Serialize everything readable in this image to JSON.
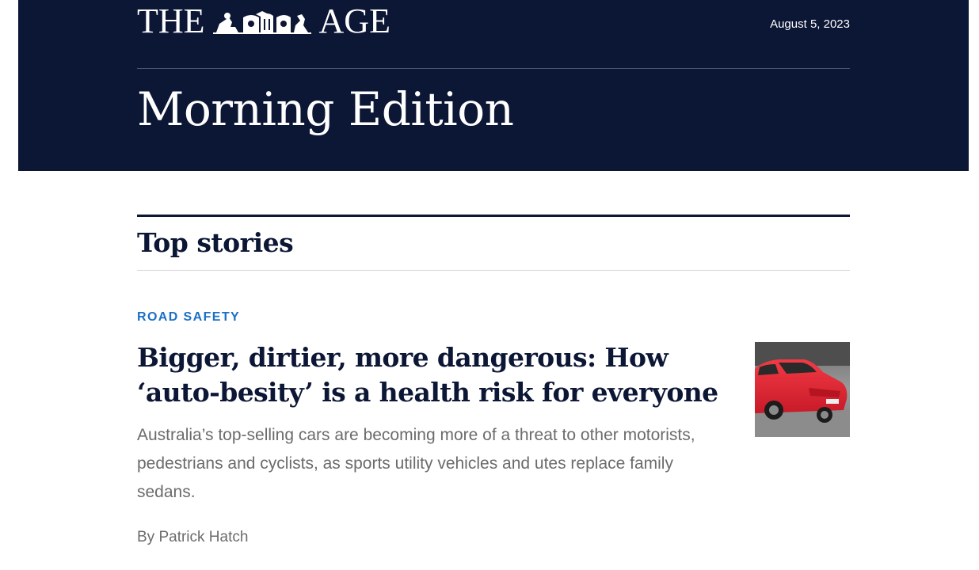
{
  "masthead": {
    "logo_left": "THE",
    "logo_right": "AGE",
    "crest_icon": "coat-of-arms-icon",
    "date": "August 5, 2023",
    "edition": "Morning Edition",
    "background": "#0c1635"
  },
  "section": {
    "title": "Top stories"
  },
  "story": {
    "kicker": "ROAD SAFETY",
    "headline": "Bigger, dirtier, more dangerous: How ‘auto-besity’ is a health risk for everyone",
    "summary": "Australia’s top-selling cars are becoming more of a threat to other motorists, pedestrians and cyclists, as sports utility vehicles and utes replace family sedans.",
    "byline": "By Patrick Hatch",
    "image_icon": "red-car-photo",
    "kicker_color": "#1b6fc7"
  }
}
